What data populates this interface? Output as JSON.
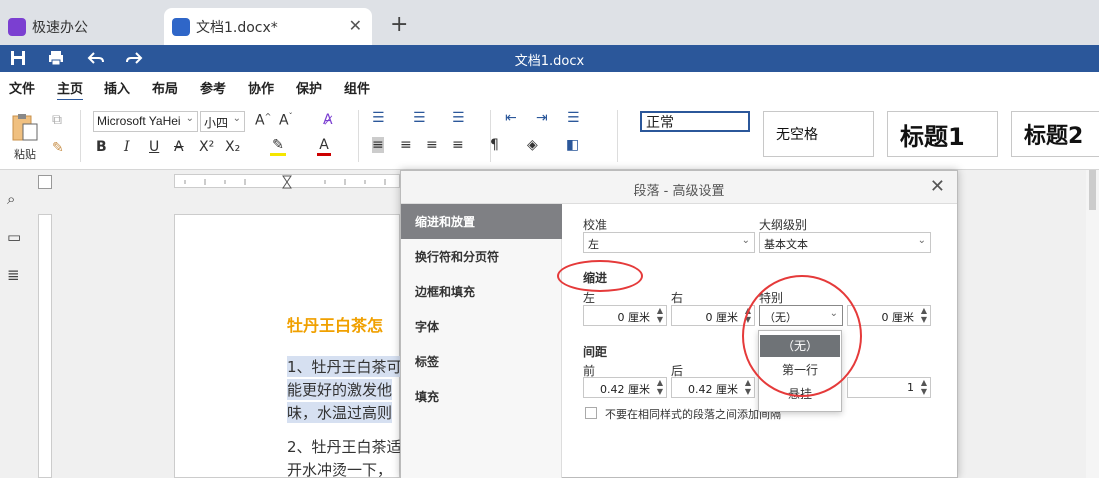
{
  "tabs": [
    {
      "label": "极速办公"
    },
    {
      "label": "文档1.docx*"
    }
  ],
  "title": "文档1.docx",
  "menu": [
    "文件",
    "主页",
    "插入",
    "布局",
    "参考",
    "协作",
    "保护",
    "组件"
  ],
  "ribbon": {
    "paste_label": "粘贴",
    "font_name": "Microsoft YaHei",
    "font_size": "小四",
    "styles": [
      "正常",
      "无空格",
      "标题1",
      "标题2"
    ]
  },
  "document": {
    "heading": "牡丹王白茶怎",
    "lines": [
      "1、牡丹王白茶可",
      "能更好的激发他",
      "味，水温过高则",
      "2、牡丹王白茶适",
      "开水冲烫一下，"
    ]
  },
  "dialog": {
    "title": "段落 - 高级设置",
    "nav": [
      "缩进和放置",
      "换行符和分页符",
      "边框和填充",
      "字体",
      "标签",
      "填充"
    ],
    "align_label": "校准",
    "align_value": "左",
    "outline_label": "大纲级别",
    "outline_value": "基本文本",
    "indent_section": "缩进",
    "left_label": "左",
    "right_label": "右",
    "special_label": "特别",
    "left_value": "0 厘米",
    "right_value": "0 厘米",
    "special_value": "（无）",
    "special_amount": "0 厘米",
    "spacing_section": "间距",
    "before_label": "前",
    "after_label": "后",
    "before_value": "0.42 厘米",
    "after_value": "0.42 厘米",
    "line_value": "1",
    "no_space_label": "不要在相同样式的段落之间添加间隔",
    "special_options": [
      "（无）",
      "第一行",
      "悬挂"
    ]
  },
  "colors": {
    "accent": "#2b579a",
    "heading": "#f0a000",
    "ring": "#e53a3a"
  }
}
